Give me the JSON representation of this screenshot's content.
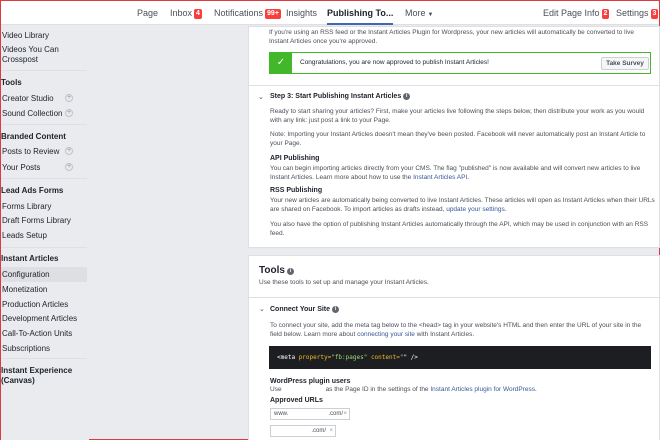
{
  "topnav": {
    "page": "Page",
    "inbox": "Inbox",
    "inbox_badge": "4",
    "notifications": "Notifications",
    "notifications_badge": "99+",
    "insights": "Insights",
    "publishing_tools": "Publishing To...",
    "more": "More",
    "edit_page_info": "Edit Page Info",
    "edit_page_info_badge": "2",
    "settings": "Settings",
    "settings_badge": "3"
  },
  "sidebar": {
    "video_library": "Video Library",
    "videos_crosspost_1": "Videos You Can",
    "videos_crosspost_2": "Crosspost",
    "tools_header": "Tools",
    "creator_studio": "Creator Studio",
    "sound_collection": "Sound Collection",
    "branded_content_header": "Branded Content",
    "posts_to_review": "Posts to Review",
    "your_posts": "Your Posts",
    "lead_ads_header": "Lead Ads Forms",
    "forms_library": "Forms Library",
    "draft_forms_library": "Draft Forms Library",
    "leads_setup": "Leads Setup",
    "instant_articles_header": "Instant Articles",
    "configuration": "Configuration",
    "monetization": "Monetization",
    "production_articles": "Production Articles",
    "development_articles": "Development Articles",
    "cta_units": "Call-To-Action Units",
    "subscriptions": "Subscriptions",
    "instant_experience_1": "Instant Experience",
    "instant_experience_2": "(Canvas)"
  },
  "step2": {
    "rss_line1": "If you're using an RSS feed or the Instant Articles Plugin for Wordpress, your new articles will automatically be converted to live",
    "rss_line2": "Instant Articles once you're approved.",
    "success_text": "Congratulations, you are now approved to publish Instant Articles!",
    "take_survey": "Take Survey"
  },
  "step3": {
    "title": "Step 3: Start Publishing Instant Articles",
    "intro_line1": "Ready to start sharing your articles? First, make your articles live following the steps below, then distribute your work as you would",
    "intro_line2": "with any link: just post a link to your Page.",
    "note_line1": "Note: Importing your Instant Articles doesn't mean they've been posted. Facebook will never automatically post an Instant Article to",
    "note_line2": "your Page.",
    "api_title": "API Publishing",
    "api_line1": "You can begin importing articles directly from your CMS. The flag \"published\" is now available and will convert new articles to live",
    "api_line2_pre": "Instant Articles. Learn more about how to use the ",
    "api_link": "Instant Articles API",
    "api_line2_post": ".",
    "rss_title": "RSS Publishing",
    "rss_pub_line1": "Your new articles are automatically being converted to live Instant Articles. These articles will open as Instant Articles when their URLs",
    "rss_pub_line2_pre": "are shared on Facebook. To import articles as drafts instead, ",
    "rss_link": "update your settings",
    "rss_pub_line2_post": ".",
    "also_line1": "You also have the option of publishing Instant Articles automatically through the API, which may be used in conjunction with an RSS",
    "also_line2": "feed."
  },
  "tools": {
    "title": "Tools",
    "subtitle": "Use these tools to set up and manage your Instant Articles.",
    "connect_title": "Connect Your Site",
    "connect_line1": "To connect your site, add the meta tag below to the <head> tag in your website's HTML and then enter the URL of your site in the",
    "connect_line2_pre": "field below. Learn more about ",
    "connect_link": "connecting your site",
    "connect_line2_post": " with Instant Articles.",
    "code_open": "<meta ",
    "code_attr1": "property=",
    "code_val1": "\"fb:pages\"",
    "code_attr2": " content=",
    "code_val2": "\"",
    "code_close": "\" />",
    "wp_title": "WordPress plugin users",
    "wp_line_pre": "Use",
    "wp_line_mid": "as the Page ID in the settings of the ",
    "wp_link": "Instant Articles plugin for WordPress",
    "wp_line_post": ".",
    "approved_title": "Approved URLs",
    "url1_a": "www.",
    "url1_b": ".com/",
    "url2": ".com/"
  }
}
